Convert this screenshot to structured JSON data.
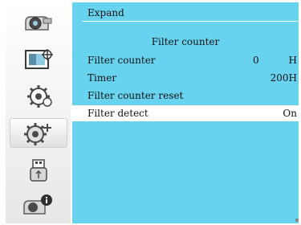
{
  "menu": {
    "icons": [
      "display-icon",
      "image-adjust-icon",
      "settings-gear-icon",
      "expand-gear-icon",
      "usb-icon",
      "info-icon"
    ],
    "active_index": 3
  },
  "panel": {
    "title": "Expand",
    "subheader": "Filter counter",
    "rows": [
      {
        "label": "Filter counter",
        "value1": "0",
        "value2": "H"
      },
      {
        "label": "Timer",
        "value2": "200H"
      },
      {
        "label": "Filter counter reset"
      },
      {
        "label": "Filter detect",
        "value2": "On",
        "selected": true
      }
    ]
  },
  "colors": {
    "panel_bg": "#67d3ee",
    "selected_bg": "#ffffff"
  }
}
